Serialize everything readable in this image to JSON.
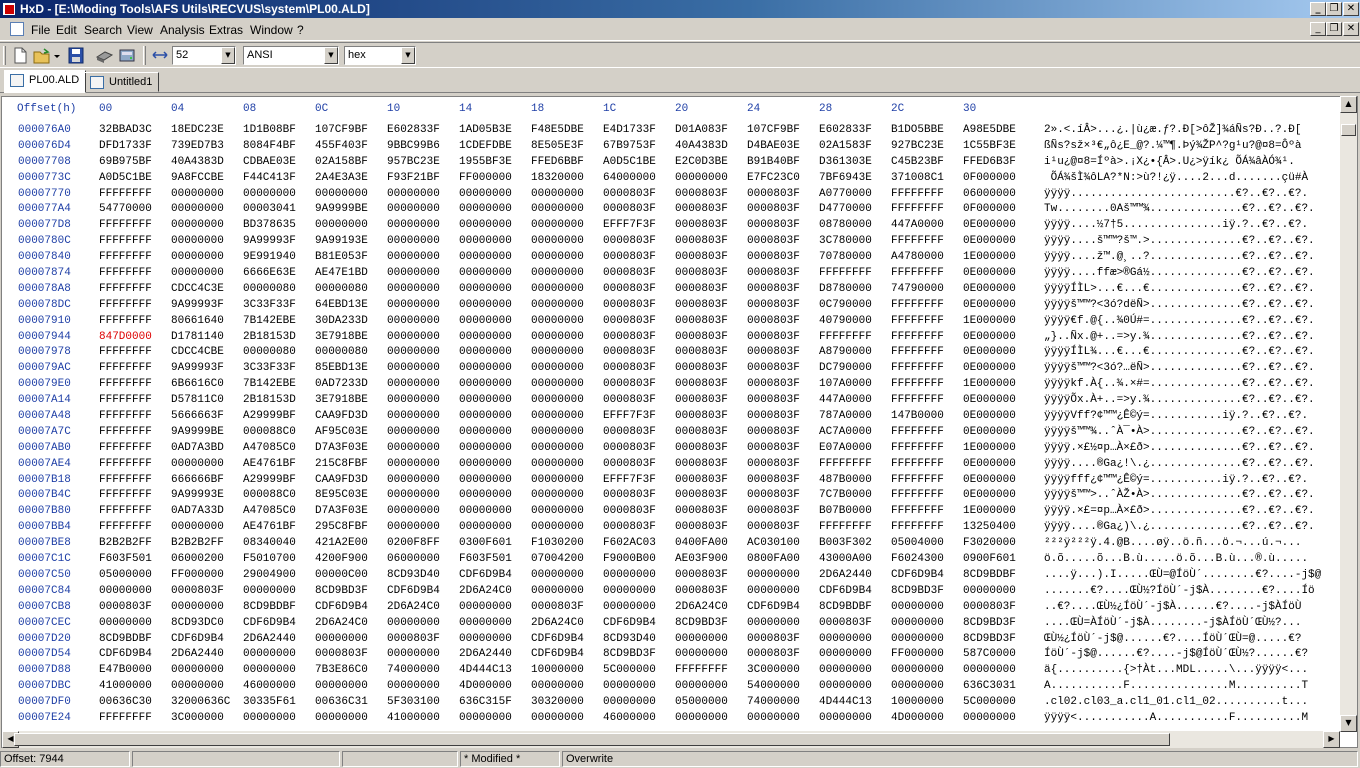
{
  "window": {
    "title": "HxD - [E:\\Moding Tools\\AFS Utils\\RECVUS\\system\\PL00.ALD]",
    "caption_buttons": [
      "_",
      "❐",
      "✕"
    ]
  },
  "menu": {
    "items": [
      "File",
      "Edit",
      "Search",
      "View",
      "Analysis",
      "Extras",
      "Window",
      "?"
    ]
  },
  "toolbar": {
    "bytes_per_row": "52",
    "charset": "ANSI",
    "display_mode": "hex"
  },
  "tabs": [
    {
      "label": "PL00.ALD",
      "active": true
    },
    {
      "label": "Untitled1",
      "active": false
    }
  ],
  "hex_header": {
    "offset_label": "Offset(h)",
    "columns": [
      "00",
      "04",
      "08",
      "0C",
      "10",
      "14",
      "18",
      "1C",
      "20",
      "24",
      "28",
      "2C",
      "30"
    ]
  },
  "rows": [
    {
      "o": "000076A0",
      "h": [
        "32BBAD3C",
        "18EDC23E",
        "1D1B08BF",
        "107CF9BF",
        "E602833F",
        "1AD05B3E",
        "F48E5DBE",
        "E4D1733F",
        "D01A083F",
        "107CF9BF",
        "E602833F",
        "B1DO5BBE",
        "A98E5DBE"
      ],
      "a": "2».<.íÂ>...¿.|ù¿æ.ƒ?.Ð[>ôŽ]¾áÑs?Ð..?.Ð["
    },
    {
      "o": "000076D4",
      "h": [
        "DFD1733F",
        "739ED7B3",
        "8084F4BF",
        "455F403F",
        "9BBC99B6",
        "1CDEFDBE",
        "8E505E3F",
        "67B9753F",
        "40A4383D",
        "D4BAE03E",
        "02A1583F",
        "927BC23E",
        "1C55BF3E"
      ],
      "a": "ßÑs?sž×³€„ô¿E_@?.¼™¶.Þý¾ŽP^?g¹u?@¤8=Ôºà"
    },
    {
      "o": "00007708",
      "h": [
        "69B975BF",
        "40A4383D",
        "CDBAE03E",
        "02A158BF",
        "957BC23E",
        "1955BF3E",
        "FFED6BBF",
        "A0D5C1BE",
        "E2C0D3BE",
        "B91B40BF",
        "D361303E",
        "C45B23BF",
        "FFED6B3F"
      ],
      "a": "i¹u¿@¤8=Íºà>.¡X¿•{Â>.U¿>ÿík¿ ÕÁ¾âÀÓ¾¹."
    },
    {
      "o": "0000773C",
      "h": [
        "A0D5C1BE",
        "9A8FCCBE",
        "F44C413F",
        "2A4E3A3E",
        "F93F21BF",
        "FF000000",
        "18320000",
        "64000000",
        "00000000",
        "E7FC23C0",
        "7BF6943E",
        "371008C1",
        "0F000000"
      ],
      "a": " ÕÁ¾šÌ¾ôLA?*N:>ù?!¿ÿ....2...d.......çü#À"
    },
    {
      "o": "00007770",
      "h": [
        "FFFFFFFF",
        "00000000",
        "00000000",
        "00000000",
        "00000000",
        "00000000",
        "00000000",
        "0000803F",
        "0000803F",
        "0000803F",
        "A0770000",
        "FFFFFFFF",
        "06000000"
      ],
      "a": "ÿÿÿÿ.........................€?..€?..€?."
    },
    {
      "o": "000077A4",
      "h": [
        "54770000",
        "00000000",
        "00003041",
        "9A9999BE",
        "00000000",
        "00000000",
        "00000000",
        "0000803F",
        "0000803F",
        "0000803F",
        "D4770000",
        "FFFFFFFF",
        "0F000000"
      ],
      "a": "Tw........0Aš™™¾..............€?..€?..€?."
    },
    {
      "o": "000077D8",
      "h": [
        "FFFFFFFF",
        "00000000",
        "BD378635",
        "00000000",
        "00000000",
        "00000000",
        "00000000",
        "EFFF7F3F",
        "0000803F",
        "0000803F",
        "08780000",
        "447A0000",
        "0E000000"
      ],
      "a": "ÿÿÿÿ....½7†5...............iÿ.?..€?..€?."
    },
    {
      "o": "0000780C",
      "h": [
        "FFFFFFFF",
        "00000000",
        "9A99993F",
        "9A99193E",
        "00000000",
        "00000000",
        "00000000",
        "0000803F",
        "0000803F",
        "0000803F",
        "3C780000",
        "FFFFFFFF",
        "0E000000"
      ],
      "a": "ÿÿÿÿ....š™™?š™.>..............€?..€?..€?."
    },
    {
      "o": "00007840",
      "h": [
        "FFFFFFFF",
        "00000000",
        "9E991940",
        "B81E053F",
        "00000000",
        "00000000",
        "00000000",
        "0000803F",
        "0000803F",
        "0000803F",
        "70780000",
        "A4780000",
        "1E000000"
      ],
      "a": "ÿÿÿÿ....ž™.@¸..?..............€?..€?..€?."
    },
    {
      "o": "00007874",
      "h": [
        "FFFFFFFF",
        "00000000",
        "6666E63E",
        "AE47E1BD",
        "00000000",
        "00000000",
        "00000000",
        "0000803F",
        "0000803F",
        "0000803F",
        "FFFFFFFF",
        "FFFFFFFF",
        "0E000000"
      ],
      "a": "ÿÿÿÿ....ffæ>®Gá½..............€?..€?..€?."
    },
    {
      "o": "000078A8",
      "h": [
        "FFFFFFFF",
        "CDCC4C3E",
        "00000080",
        "00000080",
        "00000000",
        "00000000",
        "00000000",
        "0000803F",
        "0000803F",
        "0000803F",
        "D8780000",
        "74790000",
        "0E000000"
      ],
      "a": "ÿÿÿÿÍÌL>...€...€..............€?..€?..€?."
    },
    {
      "o": "000078DC",
      "h": [
        "FFFFFFFF",
        "9A99993F",
        "3C33F33F",
        "64EBD13E",
        "00000000",
        "00000000",
        "00000000",
        "0000803F",
        "0000803F",
        "0000803F",
        "0C790000",
        "FFFFFFFF",
        "0E000000"
      ],
      "a": "ÿÿÿÿš™™?<3ó?dëÑ>..............€?..€?..€?."
    },
    {
      "o": "00007910",
      "h": [
        "FFFFFFFF",
        "80661640",
        "7B142EBE",
        "30DA233D",
        "00000000",
        "00000000",
        "00000000",
        "0000803F",
        "0000803F",
        "0000803F",
        "40790000",
        "FFFFFFFF",
        "1E000000"
      ],
      "a": "ÿÿÿÿ€f.@{..¾0Ú#=..............€?..€?..€?."
    },
    {
      "o": "00007944",
      "h": [
        "847D0000",
        "D1781140",
        "2B18153D",
        "3E7918BE",
        "00000000",
        "00000000",
        "00000000",
        "0000803F",
        "0000803F",
        "0000803F",
        "FFFFFFFF",
        "FFFFFFFF",
        "0E000000"
      ],
      "a": "„}..Ñx.@+..=>y.¾..............€?..€?..€?.",
      "sel": true
    },
    {
      "o": "00007978",
      "h": [
        "FFFFFFFF",
        "CDCC4CBE",
        "00000080",
        "00000080",
        "00000000",
        "00000000",
        "00000000",
        "0000803F",
        "0000803F",
        "0000803F",
        "A8790000",
        "FFFFFFFF",
        "0E000000"
      ],
      "a": "ÿÿÿÿÍÌL¾...€...€..............€?..€?..€?."
    },
    {
      "o": "000079AC",
      "h": [
        "FFFFFFFF",
        "9A99993F",
        "3C33F33F",
        "85EBD13E",
        "00000000",
        "00000000",
        "00000000",
        "0000803F",
        "0000803F",
        "0000803F",
        "DC790000",
        "FFFFFFFF",
        "0E000000"
      ],
      "a": "ÿÿÿÿš™™?<3ó?…ëÑ>..............€?..€?..€?."
    },
    {
      "o": "000079E0",
      "h": [
        "FFFFFFFF",
        "6B6616C0",
        "7B142EBE",
        "0AD7233D",
        "00000000",
        "00000000",
        "00000000",
        "0000803F",
        "0000803F",
        "0000803F",
        "107A0000",
        "FFFFFFFF",
        "1E000000"
      ],
      "a": "ÿÿÿÿkf.À{..¾.×#=..............€?..€?..€?."
    },
    {
      "o": "00007A14",
      "h": [
        "FFFFFFFF",
        "D57811C0",
        "2B18153D",
        "3E7918BE",
        "00000000",
        "00000000",
        "00000000",
        "0000803F",
        "0000803F",
        "0000803F",
        "447A0000",
        "FFFFFFFF",
        "0E000000"
      ],
      "a": "ÿÿÿÿÕx.À+..=>y.¾..............€?..€?..€?."
    },
    {
      "o": "00007A48",
      "h": [
        "FFFFFFFF",
        "5666663F",
        "A29999BF",
        "CAA9FD3D",
        "00000000",
        "00000000",
        "00000000",
        "EFFF7F3F",
        "0000803F",
        "0000803F",
        "787A0000",
        "147B0000",
        "0E000000"
      ],
      "a": "ÿÿÿÿVff?¢™™¿Ê©ý=...........iÿ.?..€?..€?."
    },
    {
      "o": "00007A7C",
      "h": [
        "FFFFFFFF",
        "9A9999BE",
        "000088C0",
        "AF95C03E",
        "00000000",
        "00000000",
        "00000000",
        "0000803F",
        "0000803F",
        "0000803F",
        "AC7A0000",
        "FFFFFFFF",
        "0E000000"
      ],
      "a": "ÿÿÿÿš™™¾..ˆÀ¯•À>..............€?..€?..€?."
    },
    {
      "o": "00007AB0",
      "h": [
        "FFFFFFFF",
        "0AD7A3BD",
        "A47085C0",
        "D7A3F03E",
        "00000000",
        "00000000",
        "00000000",
        "0000803F",
        "0000803F",
        "0000803F",
        "E07A0000",
        "FFFFFFFF",
        "1E000000"
      ],
      "a": "ÿÿÿÿ.×£½¤p…À×£ð>..............€?..€?..€?."
    },
    {
      "o": "00007AE4",
      "h": [
        "FFFFFFFF",
        "00000000",
        "AE4761BF",
        "215C8FBF",
        "00000000",
        "00000000",
        "00000000",
        "0000803F",
        "0000803F",
        "0000803F",
        "FFFFFFFF",
        "FFFFFFFF",
        "0E000000"
      ],
      "a": "ÿÿÿÿ....®Ga¿!\\.¿..............€?..€?..€?."
    },
    {
      "o": "00007B18",
      "h": [
        "FFFFFFFF",
        "666666BF",
        "A29999BF",
        "CAA9FD3D",
        "00000000",
        "00000000",
        "00000000",
        "EFFF7F3F",
        "0000803F",
        "0000803F",
        "487B0000",
        "FFFFFFFF",
        "0E000000"
      ],
      "a": "ÿÿÿÿfff¿¢™™¿Ê©ý=...........iÿ.?..€?..€?."
    },
    {
      "o": "00007B4C",
      "h": [
        "FFFFFFFF",
        "9A99993E",
        "000088C0",
        "8E95C03E",
        "00000000",
        "00000000",
        "00000000",
        "0000803F",
        "0000803F",
        "0000803F",
        "7C7B0000",
        "FFFFFFFF",
        "0E000000"
      ],
      "a": "ÿÿÿÿš™™>..ˆÀŽ•À>..............€?..€?..€?."
    },
    {
      "o": "00007B80",
      "h": [
        "FFFFFFFF",
        "0AD7A33D",
        "A47085C0",
        "D7A3F03E",
        "00000000",
        "00000000",
        "00000000",
        "0000803F",
        "0000803F",
        "0000803F",
        "B07B0000",
        "FFFFFFFF",
        "1E000000"
      ],
      "a": "ÿÿÿÿ.×£=¤p…À×£ð>..............€?..€?..€?."
    },
    {
      "o": "00007BB4",
      "h": [
        "FFFFFFFF",
        "00000000",
        "AE4761BF",
        "295C8FBF",
        "00000000",
        "00000000",
        "00000000",
        "0000803F",
        "0000803F",
        "0000803F",
        "FFFFFFFF",
        "FFFFFFFF",
        "13250400"
      ],
      "a": "ÿÿÿÿ....®Ga¿)\\.¿..............€?..€?..€?."
    },
    {
      "o": "00007BE8",
      "h": [
        "B2B2B2FF",
        "B2B2B2FF",
        "08340040",
        "421A2E00",
        "0200F8FF",
        "0300F601",
        "F1030200",
        "F602AC03",
        "0400FA00",
        "AC030100",
        "B003F302",
        "05004000",
        "F3020000"
      ],
      "a": "²²²ÿ²²²ÿ.4.@B....øÿ..ö.ñ...ö.¬...ú.¬..."
    },
    {
      "o": "00007C1C",
      "h": [
        "F603F501",
        "06000200",
        "F5010700",
        "4200F900",
        "06000000",
        "F603F501",
        "07004200",
        "F9000B00",
        "AE03F900",
        "0800FA00",
        "43000A00",
        "F6024300",
        "0900F601"
      ],
      "a": "ö.õ.....õ...B.ù.....ö.õ...B.ù...®.ù....."
    },
    {
      "o": "00007C50",
      "h": [
        "05000000",
        "FF000000",
        "29004900",
        "00000C00",
        "8CD93D40",
        "CDF6D9B4",
        "00000000",
        "00000000",
        "0000803F",
        "00000000",
        "2D6A2440",
        "CDF6D9B4",
        "8CD9BDBF"
      ],
      "a": "....ÿ...).I.....ŒÙ=@ÍöÙ´........€?....-j$@"
    },
    {
      "o": "00007C84",
      "h": [
        "00000000",
        "0000803F",
        "00000000",
        "8CD9BD3F",
        "CDF6D9B4",
        "2D6A24C0",
        "00000000",
        "00000000",
        "0000803F",
        "00000000",
        "CDF6D9B4",
        "8CD9BD3F",
        "00000000"
      ],
      "a": ".......€?....ŒÙ½?ÍöÙ´-j$À........€?....Íö"
    },
    {
      "o": "00007CB8",
      "h": [
        "0000803F",
        "00000000",
        "8CD9BDBF",
        "CDF6D9B4",
        "2D6A24C0",
        "00000000",
        "0000803F",
        "00000000",
        "2D6A24C0",
        "CDF6D9B4",
        "8CD9BDBF",
        "00000000",
        "0000803F"
      ],
      "a": "..€?....ŒÙ½¿ÍöÙ´-j$À......€?....-j$ÀÍöÙ"
    },
    {
      "o": "00007CEC",
      "h": [
        "00000000",
        "8CD93DC0",
        "CDF6D9B4",
        "2D6A24C0",
        "00000000",
        "00000000",
        "2D6A24C0",
        "CDF6D9B4",
        "8CD9BD3F",
        "00000000",
        "0000803F",
        "00000000",
        "8CD9BD3F"
      ],
      "a": "....ŒÙ=ÀÍöÙ´-j$À........-j$ÀÍöÙ´ŒÙ½?..."
    },
    {
      "o": "00007D20",
      "h": [
        "8CD9BDBF",
        "CDF6D9B4",
        "2D6A2440",
        "00000000",
        "0000803F",
        "00000000",
        "CDF6D9B4",
        "8CD93D40",
        "00000000",
        "0000803F",
        "00000000",
        "00000000",
        "8CD9BD3F"
      ],
      "a": "ŒÙ½¿ÍöÙ´-j$@......€?....ÍöÙ´ŒÙ=@.....€?"
    },
    {
      "o": "00007D54",
      "h": [
        "CDF6D9B4",
        "2D6A2440",
        "00000000",
        "0000803F",
        "00000000",
        "2D6A2440",
        "CDF6D9B4",
        "8CD9BD3F",
        "00000000",
        "0000803F",
        "00000000",
        "FF000000",
        "587C0000"
      ],
      "a": "ÍöÙ´-j$@......€?....-j$@ÍöÙ´ŒÙ½?......€?"
    },
    {
      "o": "00007D88",
      "h": [
        "E47B0000",
        "00000000",
        "00000000",
        "7B3E86C0",
        "74000000",
        "4D444C13",
        "10000000",
        "5C000000",
        "FFFFFFFF",
        "3C000000",
        "00000000",
        "00000000",
        "00000000"
      ],
      "a": "ä{..........{>†Àt...MDL.....\\...ÿÿÿÿ<..."
    },
    {
      "o": "00007DBC",
      "h": [
        "41000000",
        "00000000",
        "46000000",
        "00000000",
        "00000000",
        "4D000000",
        "00000000",
        "00000000",
        "00000000",
        "54000000",
        "00000000",
        "00000000",
        "636C3031"
      ],
      "a": "A...........F...............M..........T"
    },
    {
      "o": "00007DF0",
      "h": [
        "00636C30",
        "32000636C",
        "30335F61",
        "00636C31",
        "5F303100",
        "636C315F",
        "30320000",
        "00000000",
        "05000000",
        "74000000",
        "4D444C13",
        "10000000",
        "5C000000"
      ],
      "a": ".cl02.cl03_a.cl1_01.cl1_02..........t..."
    },
    {
      "o": "00007E24",
      "h": [
        "FFFFFFFF",
        "3C000000",
        "00000000",
        "00000000",
        "41000000",
        "00000000",
        "00000000",
        "46000000",
        "00000000",
        "00000000",
        "00000000",
        "4D000000",
        "00000000"
      ],
      "a": "ÿÿÿÿ<...........A...........F..........M"
    }
  ],
  "status": {
    "offset": "Offset: 7944",
    "modified": "* Modified *",
    "mode": "Overwrite"
  }
}
